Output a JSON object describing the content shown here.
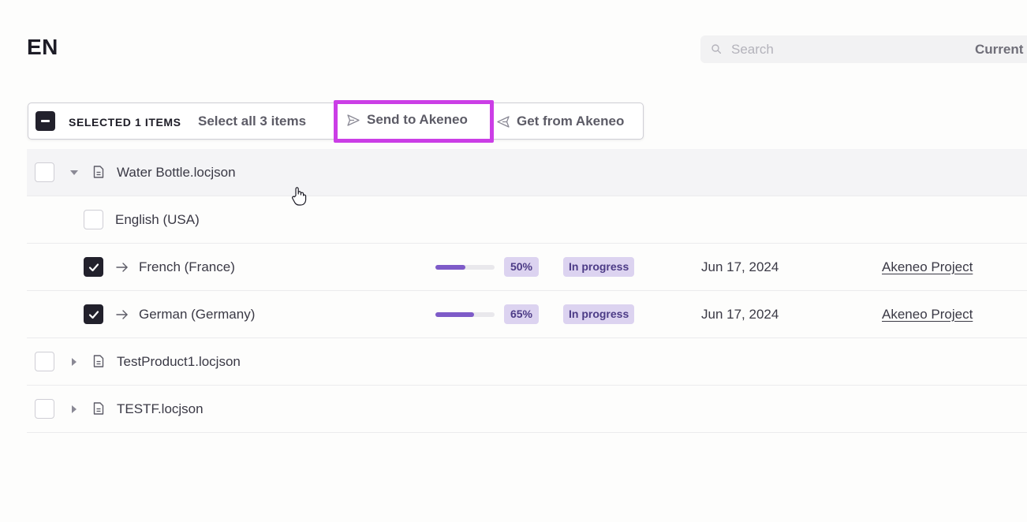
{
  "header": {
    "title": "EN",
    "search_placeholder": "Search",
    "filter_label": "Current"
  },
  "toolbar": {
    "selected_label": "SELECTED 1 ITEMS",
    "select_all_label": "Select all 3 items",
    "send_label": "Send to Akeneo",
    "get_label": "Get from Akeneo",
    "highlight_color": "#cb3ee6"
  },
  "rows": [
    {
      "name": "Water Bottle.locjson",
      "type": "file",
      "expanded": true,
      "checked": false
    },
    {
      "name": "English (USA)",
      "type": "locale-source",
      "checked": false
    },
    {
      "name": "French (France)",
      "type": "locale",
      "checked": true,
      "progress": 50,
      "progress_label": "50%",
      "status": "In progress",
      "date": "Jun 17, 2024",
      "project": "Akeneo Project"
    },
    {
      "name": "German (Germany)",
      "type": "locale",
      "checked": true,
      "progress": 65,
      "progress_label": "65%",
      "status": "In progress",
      "date": "Jun 17, 2024",
      "project": "Akeneo Project"
    },
    {
      "name": "TestProduct1.locjson",
      "type": "file",
      "expanded": false,
      "checked": false
    },
    {
      "name": "TESTF.locjson",
      "type": "file",
      "expanded": false,
      "checked": false
    }
  ],
  "colors": {
    "accent": "#7e5bc8",
    "badge_bg": "#dcd3f0",
    "badge_text": "#4c3b86"
  },
  "icons": {
    "search": "search-icon",
    "send": "send-icon",
    "get": "receive-icon",
    "file": "file-icon",
    "caret": "caret-icon",
    "arrow": "arrow-right-icon",
    "cursor": "hand-pointer-icon"
  }
}
